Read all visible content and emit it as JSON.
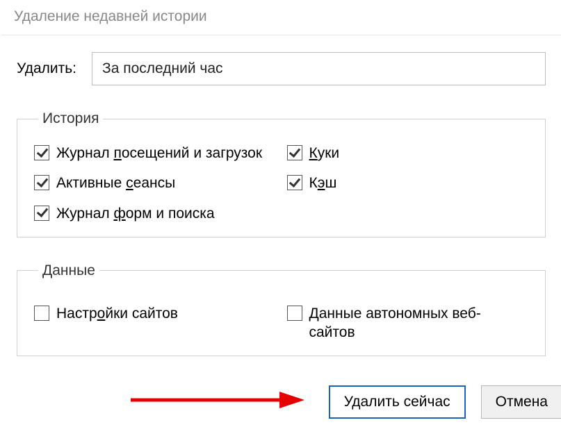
{
  "title": "Удаление недавней истории",
  "delete_label": "Удалить:",
  "select_value": "За последний час",
  "groups": {
    "history": {
      "legend": "История",
      "items": [
        {
          "label": "Журнал посещений и загрузок",
          "underline": "п",
          "checked": true
        },
        {
          "label": "Куки",
          "underline": "К",
          "checked": true
        },
        {
          "label": "Активные сеансы",
          "underline": "с",
          "checked": true
        },
        {
          "label": "Кэш",
          "underline": "э",
          "checked": true
        },
        {
          "label": "Журнал форм и поиска",
          "underline": "ф",
          "checked": true
        }
      ]
    },
    "data": {
      "legend": "Данные",
      "items": [
        {
          "label": "Настройки сайтов",
          "underline": "о",
          "checked": false
        },
        {
          "label": "Данные автономных веб-сайтов",
          "underline": "",
          "checked": false
        }
      ]
    }
  },
  "buttons": {
    "delete_now": "Удалить сейчас",
    "cancel": "Отмена"
  }
}
